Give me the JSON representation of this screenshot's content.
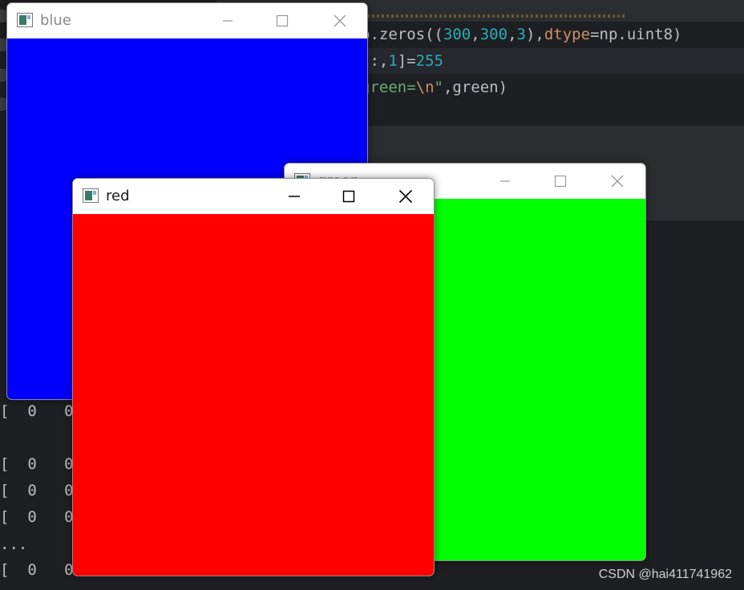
{
  "editor": {
    "line1": {
      "prefix": "p.zeros((",
      "n1": "300",
      "c1": ",",
      "n2": "300",
      "c2": ",",
      "n3": "3",
      "c3": "),",
      "kw": "dtype",
      "suffix": "=np.uint8)"
    },
    "line2": {
      "prefix": ",:,",
      "n1": "1",
      "mid": "]=",
      "n2": "255"
    },
    "line3": {
      "str1": "green=",
      "esc": "\\n",
      "str2": "\"",
      "suffix": ",green)"
    }
  },
  "console": {
    "rows": [
      {
        "text": "[  0   0"
      },
      {
        "text": "[  0   0"
      },
      {
        "text": "[  0   0"
      },
      {
        "text": "[  0   0"
      },
      {
        "text": "..."
      },
      {
        "text": "[  0   0"
      }
    ]
  },
  "windows": {
    "blue": {
      "title": "blue",
      "color": "#0000ff"
    },
    "green": {
      "title": "green",
      "color": "#00ff00"
    },
    "red": {
      "title": "red",
      "color": "#ff0000"
    }
  },
  "icons": {
    "app": "opencv-window-icon",
    "minimize": "minimize-icon",
    "maximize": "maximize-icon",
    "close": "close-icon"
  },
  "watermark": "CSDN @hai411741962"
}
